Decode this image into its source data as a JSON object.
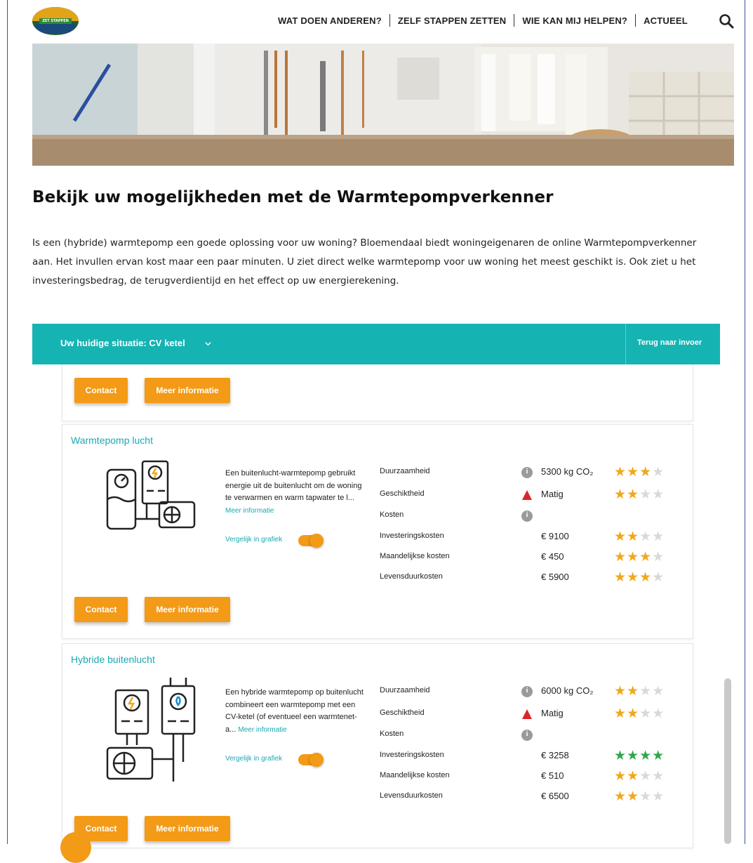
{
  "header": {
    "logo_text": "GEMEENTE BLOEMENDAAL · ZET STAPPEN",
    "nav": [
      "WAT DOEN ANDEREN?",
      "ZELF STAPPEN ZETTEN",
      "WIE KAN MIJ HELPEN?",
      "ACTUEEL"
    ],
    "search_icon": "search-icon"
  },
  "page": {
    "title": "Bekijk uw mogelijkheden met de Warmtepompverkenner",
    "intro": "Is een (hybride) warmtepomp een goede oplossing voor uw woning? Bloemendaal biedt woningeigenaren de online Warmtepompverkenner aan. Het invullen ervan kost maar een paar minuten. U ziet direct welke warmtepomp voor uw woning het meest geschikt is. Ook ziet u het investeringsbedrag, de terugverdientijd en het effect op uw energierekening."
  },
  "tool": {
    "situation": "Uw huidige situatie: CV ketel",
    "back": "Terug naar invoer",
    "contact_label": "Contact",
    "more_label": "Meer informatie"
  },
  "cards": [
    {
      "title": "Warmtepomp lucht",
      "description": "Een buitenlucht-warmtepomp gebruikt energie uit de buitenlucht om de woning te verwarmen en warm tapwater te l...",
      "more_link": "Meer informatie",
      "compare": "Vergelijk in grafiek",
      "compare_on": true,
      "rows": [
        {
          "label": "Duurzaamheid",
          "icon": "info-icon",
          "value": "5300 kg CO₂",
          "stars": 3
        },
        {
          "label": "Geschiktheid",
          "icon": "warning-icon",
          "value": "Matig",
          "stars": 2
        },
        {
          "label": "Kosten",
          "icon": "info-icon",
          "value": "",
          "stars": 0
        },
        {
          "label": "Investeringskosten",
          "icon": "",
          "value": "€ 9100",
          "stars": 2
        },
        {
          "label": "Maandelijkse kosten",
          "icon": "",
          "value": "€ 450",
          "stars": 3
        },
        {
          "label": "Levensduurkosten",
          "icon": "",
          "value": "€ 5900",
          "stars": 3
        }
      ]
    },
    {
      "title": "Hybride buitenlucht",
      "description": "Een hybride warmtepomp op buitenlucht combineert een warmtepomp met een CV-ketel (of eventueel een warmtenet-a...",
      "more_link": "Meer informatie",
      "compare": "Vergelijk in grafiek",
      "compare_on": true,
      "rows": [
        {
          "label": "Duurzaamheid",
          "icon": "info-icon",
          "value": "6000 kg CO₂",
          "stars": 2
        },
        {
          "label": "Geschiktheid",
          "icon": "warning-icon",
          "value": "Matig",
          "stars": 2
        },
        {
          "label": "Kosten",
          "icon": "info-icon",
          "value": "",
          "stars": 0
        },
        {
          "label": "Investeringskosten",
          "icon": "",
          "value": "€ 3258",
          "stars": 4,
          "color": "#2ea84a"
        },
        {
          "label": "Maandelijkse kosten",
          "icon": "",
          "value": "€ 510",
          "stars": 2
        },
        {
          "label": "Levensduurkosten",
          "icon": "",
          "value": "€ 6500",
          "stars": 2
        }
      ]
    }
  ],
  "colors": {
    "teal": "#16b3b3",
    "orange": "#f39a16",
    "star": "#f0a81c",
    "star_green": "#2ea84a"
  }
}
